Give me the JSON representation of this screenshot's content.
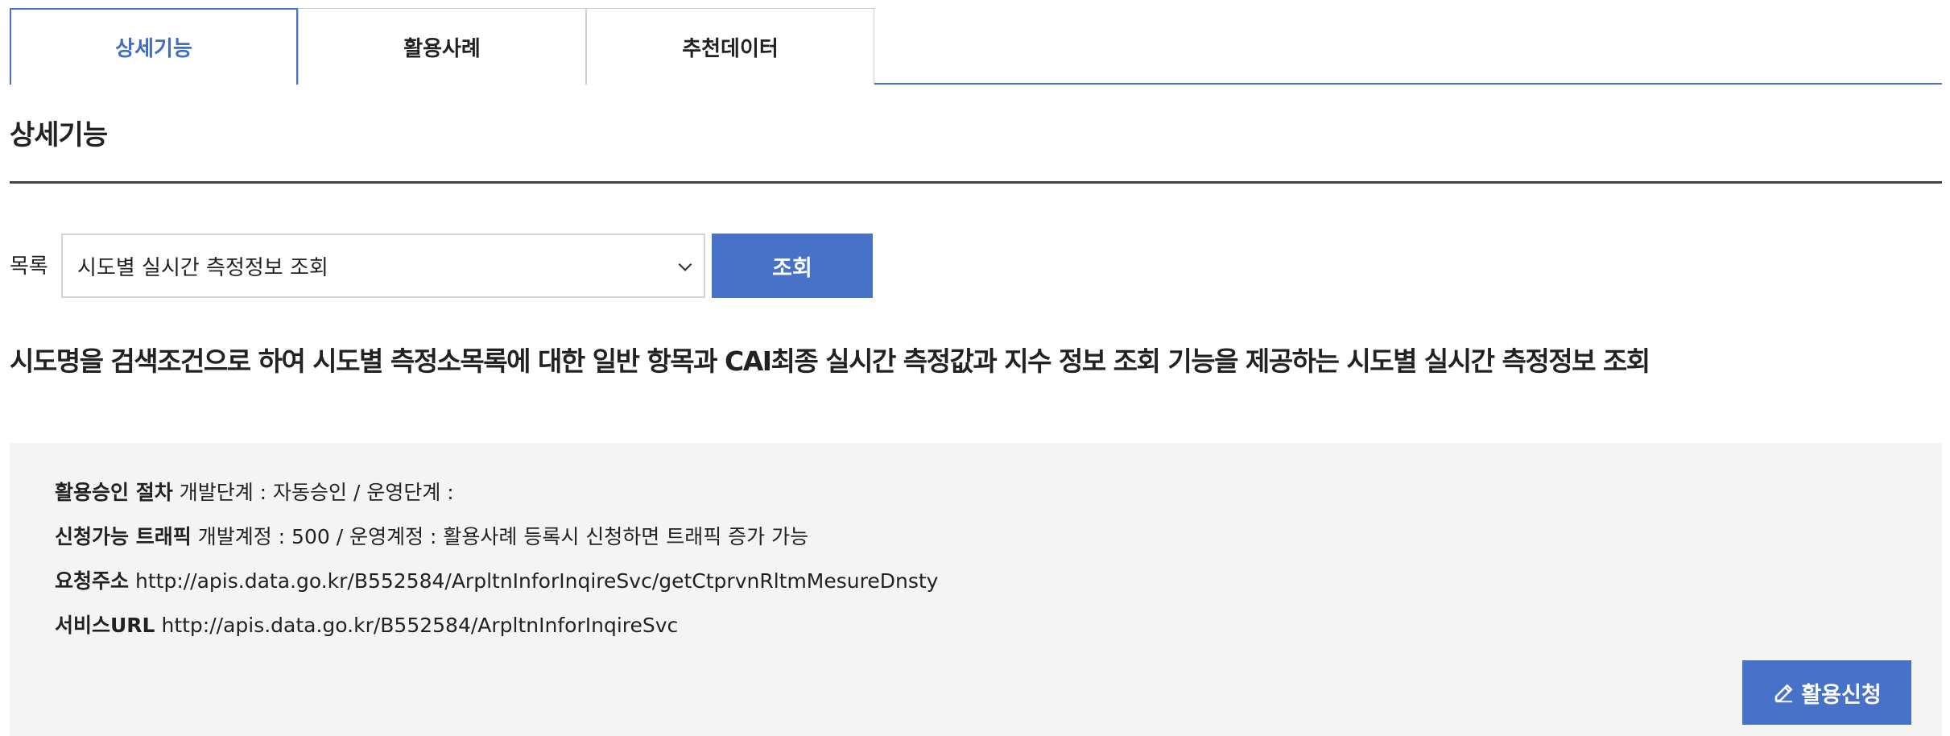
{
  "tabs": [
    {
      "label": "상세기능",
      "active": true
    },
    {
      "label": "활용사례",
      "active": false
    },
    {
      "label": "추천데이터",
      "active": false
    }
  ],
  "section": {
    "title": "상세기능"
  },
  "operation_select": {
    "label": "목록",
    "selected": "시도별 실시간 측정정보 조회",
    "search_label": "조회"
  },
  "description": "시도명을 검색조건으로 하여 시도별 측정소목록에 대한 일반 항목과 CAI최종 실시간 측정값과 지수 정보 조회 기능을 제공하는 시도별 실시간 측정정보 조회",
  "info": {
    "approval": {
      "key": "활용승인 절차",
      "value": "개발단계 : 자동승인 / 운영단계 :"
    },
    "traffic": {
      "key": "신청가능 트래픽",
      "value": "개발계정 : 500 / 운영계정 : 활용사례 등록시 신청하면 트래픽 증가 가능"
    },
    "request_url": {
      "key": "요청주소",
      "value": "http://apis.data.go.kr/B552584/ArpltnInforInqireSvc/getCtprvnRltmMesureDnsty"
    },
    "service_url": {
      "key": "서비스URL",
      "value": "http://apis.data.go.kr/B552584/ArpltnInforInqireSvc"
    },
    "apply_label": "활용신청",
    "apply_icon": "pencil-icon"
  },
  "colors": {
    "accent": "#4772c7",
    "panel_bg": "#f4f4f4",
    "rule": "#444444"
  }
}
